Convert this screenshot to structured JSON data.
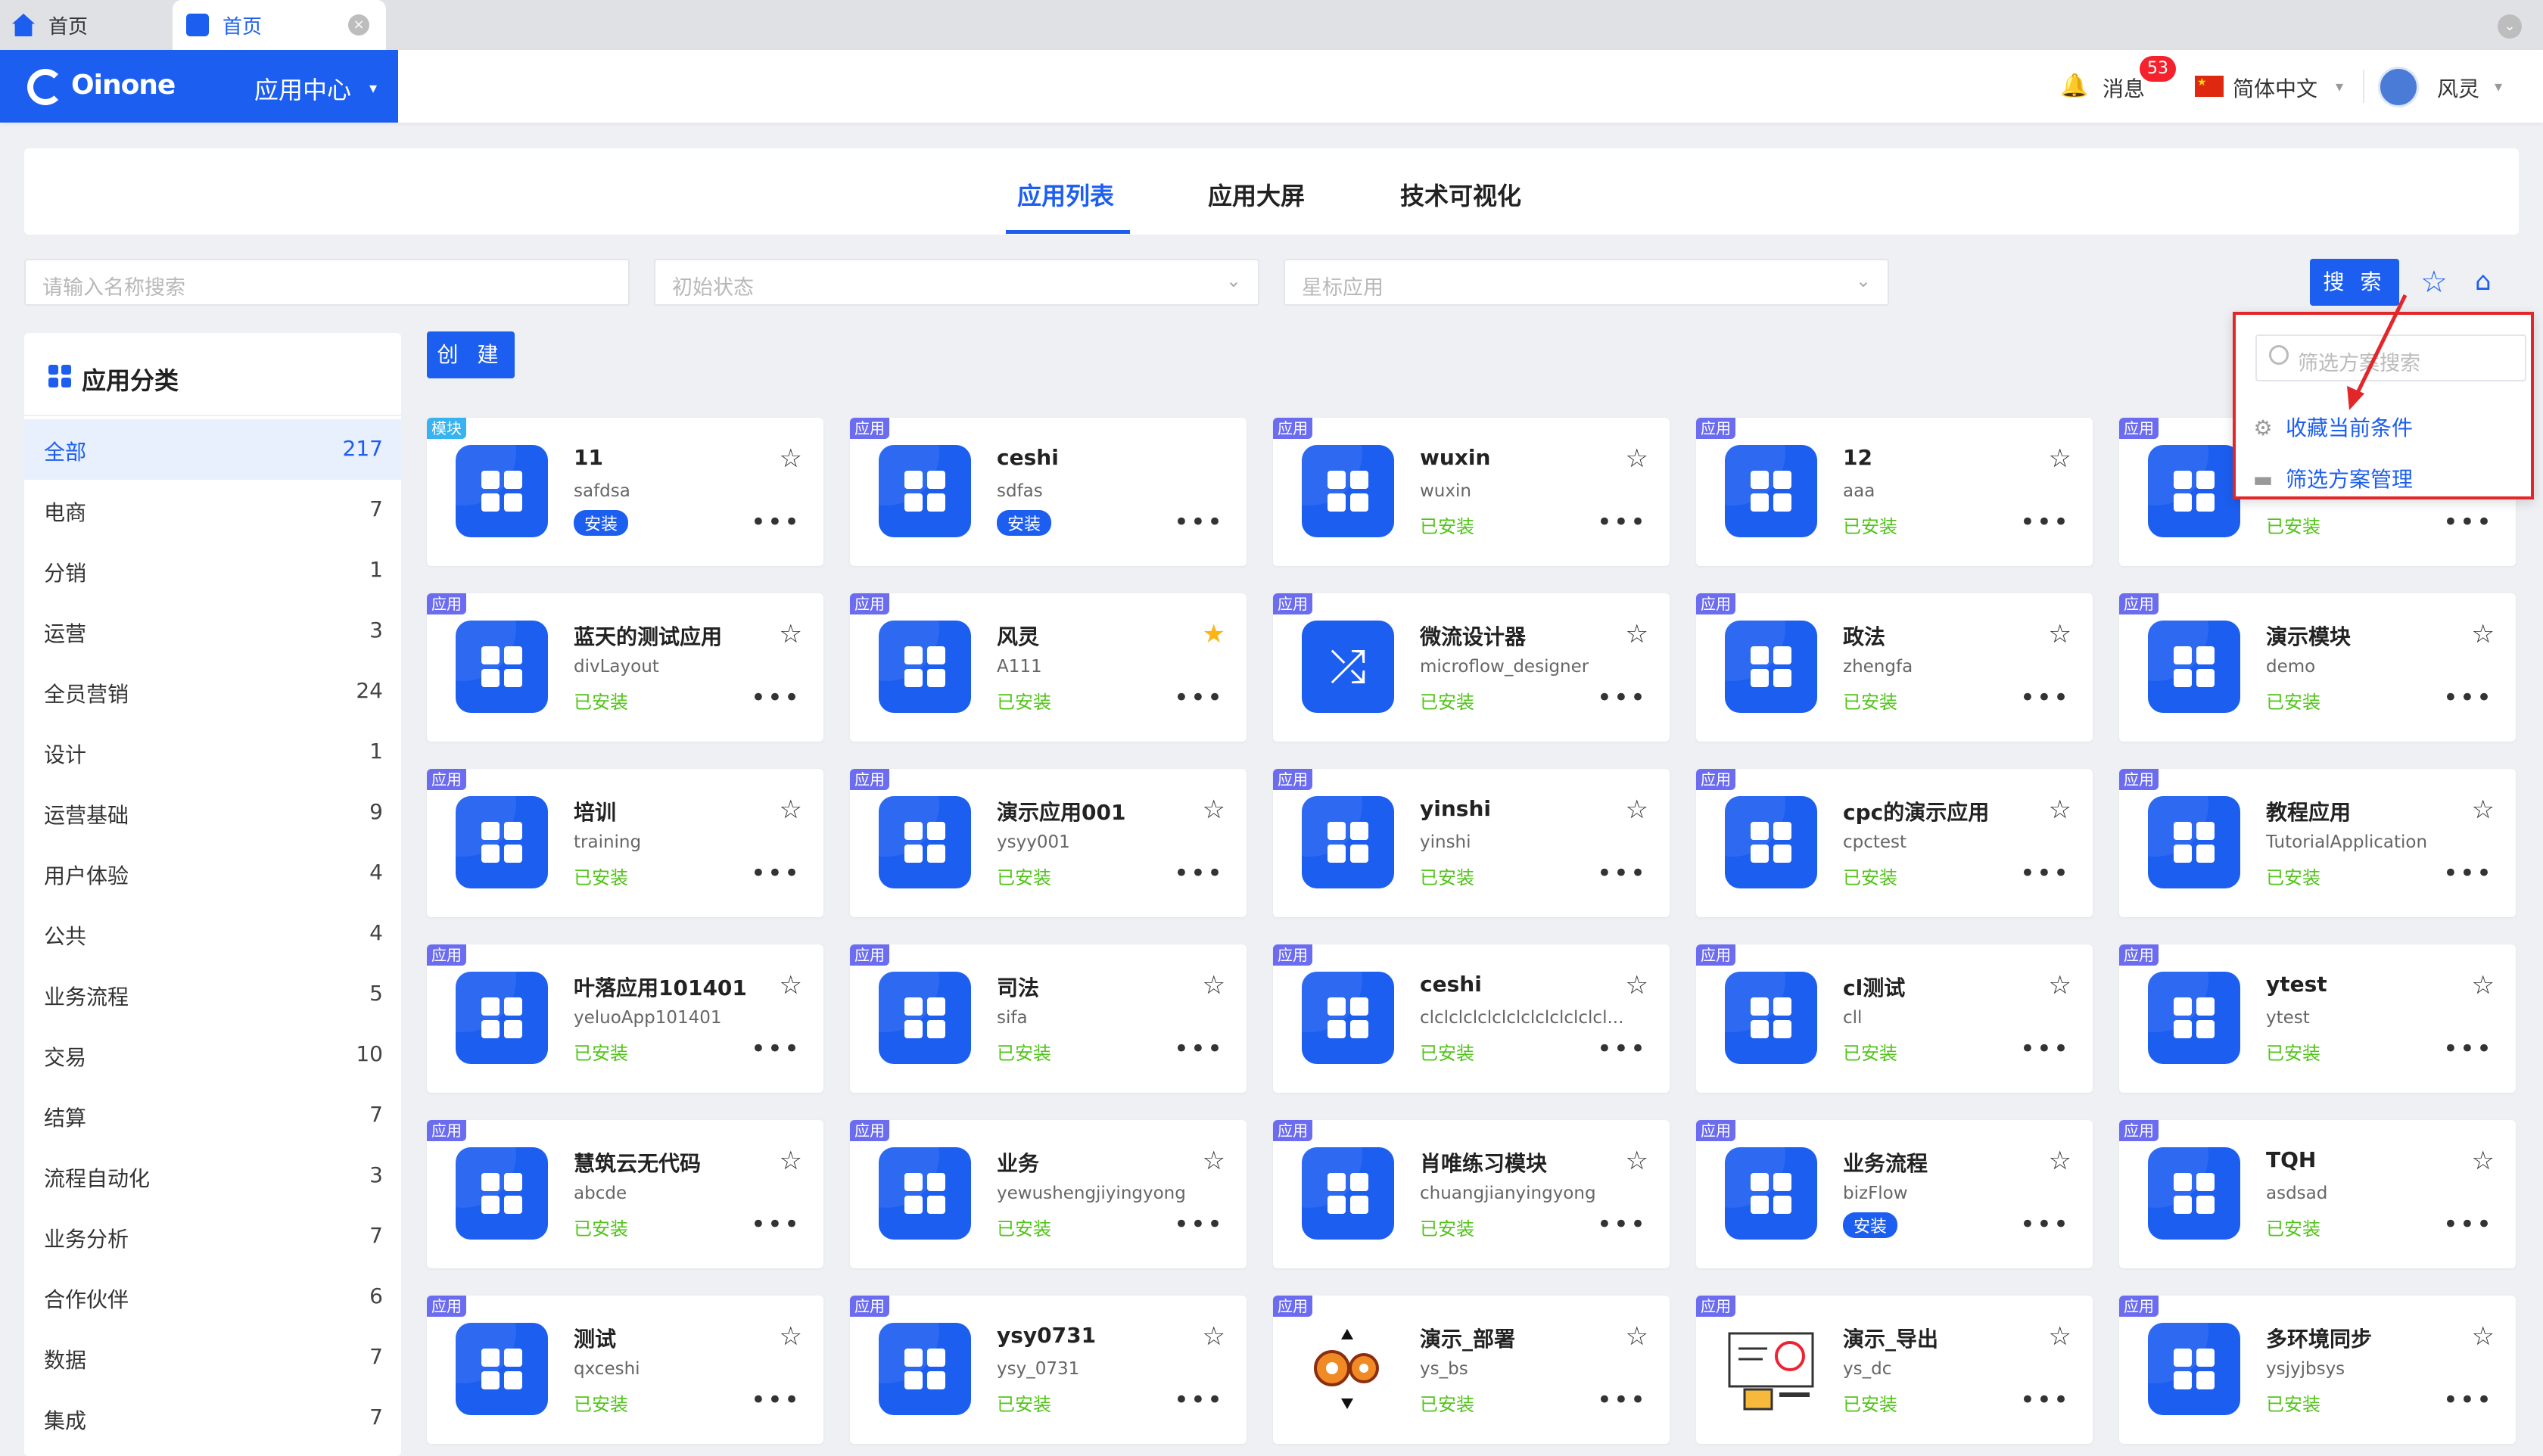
{
  "browser": {
    "tabs": [
      {
        "label": "首页"
      },
      {
        "label": "首页",
        "active": true,
        "close": "×"
      }
    ],
    "menu_chevron": "⌄"
  },
  "header": {
    "brand": "Oinone",
    "app_center": "应用中心",
    "caret": "▾",
    "messages_label": "消息",
    "messages_count": "53",
    "language": "简体中文",
    "user": "风灵",
    "brand_color": "#1c5ef0"
  },
  "nav": {
    "tabs": [
      "应用列表",
      "应用大屏",
      "技术可视化"
    ],
    "active_index": 0
  },
  "filters": {
    "name_placeholder": "请输入名称搜索",
    "status_placeholder": "初始状态",
    "star_placeholder": "星标应用",
    "search_label": "搜 索",
    "chevron": "⌄"
  },
  "sidebar": {
    "title": "应用分类",
    "categories": [
      {
        "name": "全部",
        "count": "217",
        "selected": true
      },
      {
        "name": "电商",
        "count": "7"
      },
      {
        "name": "分销",
        "count": "1"
      },
      {
        "name": "运营",
        "count": "3"
      },
      {
        "name": "全员营销",
        "count": "24"
      },
      {
        "name": "设计",
        "count": "1"
      },
      {
        "name": "运营基础",
        "count": "9"
      },
      {
        "name": "用户体验",
        "count": "4"
      },
      {
        "name": "公共",
        "count": "4"
      },
      {
        "name": "业务流程",
        "count": "5"
      },
      {
        "name": "交易",
        "count": "10"
      },
      {
        "name": "结算",
        "count": "7"
      },
      {
        "name": "流程自动化",
        "count": "3"
      },
      {
        "name": "业务分析",
        "count": "7"
      },
      {
        "name": "合作伙伴",
        "count": "6"
      },
      {
        "name": "数据",
        "count": "7"
      },
      {
        "name": "集成",
        "count": "7"
      }
    ]
  },
  "create_label": "创 建",
  "symbols": {
    "star_empty": "☆",
    "star_full": "★",
    "more": "•••"
  },
  "apps": [
    {
      "tag": "模块",
      "title": "11",
      "code": "safdsa",
      "status": "安装",
      "status_kind": "button",
      "starred": false,
      "icon": "grid"
    },
    {
      "tag": "应用",
      "title": "ceshi",
      "code": "sdfas",
      "status": "安装",
      "status_kind": "button",
      "starred": false,
      "icon": "grid",
      "no_star": true
    },
    {
      "tag": "应用",
      "title": "wuxin",
      "code": "wuxin",
      "status": "已安装",
      "status_kind": "text",
      "starred": false,
      "icon": "grid"
    },
    {
      "tag": "应用",
      "title": "12",
      "code": "aaa",
      "status": "已安装",
      "status_kind": "text",
      "starred": false,
      "icon": "grid"
    },
    {
      "tag": "应用",
      "title": "",
      "code": "",
      "status": "已安装",
      "status_kind": "text",
      "starred": false,
      "icon": "grid",
      "no_star": true
    },
    {
      "tag": "应用",
      "title": "蓝天的测试应用",
      "code": "divLayout",
      "status": "已安装",
      "status_kind": "text",
      "starred": false,
      "icon": "grid"
    },
    {
      "tag": "应用",
      "title": "风灵",
      "code": "A111",
      "status": "已安装",
      "status_kind": "text",
      "starred": true,
      "icon": "grid"
    },
    {
      "tag": "应用",
      "title": "微流设计器",
      "code": "microflow_designer",
      "status": "已安装",
      "status_kind": "text",
      "starred": false,
      "icon": "shuffle"
    },
    {
      "tag": "应用",
      "title": "政法",
      "code": "zhengfa",
      "status": "已安装",
      "status_kind": "text",
      "starred": false,
      "icon": "grid"
    },
    {
      "tag": "应用",
      "title": "演示模块",
      "code": "demo",
      "status": "已安装",
      "status_kind": "text",
      "starred": false,
      "icon": "grid"
    },
    {
      "tag": "应用",
      "title": "培训",
      "code": "training",
      "status": "已安装",
      "status_kind": "text",
      "starred": false,
      "icon": "grid"
    },
    {
      "tag": "应用",
      "title": "演示应用001",
      "code": "ysyy001",
      "status": "已安装",
      "status_kind": "text",
      "starred": false,
      "icon": "grid"
    },
    {
      "tag": "应用",
      "title": "yinshi",
      "code": "yinshi",
      "status": "已安装",
      "status_kind": "text",
      "starred": false,
      "icon": "grid"
    },
    {
      "tag": "应用",
      "title": "cpc的演示应用",
      "code": "cpctest",
      "status": "已安装",
      "status_kind": "text",
      "starred": false,
      "icon": "grid"
    },
    {
      "tag": "应用",
      "title": "教程应用",
      "code": "TutorialApplication",
      "status": "已安装",
      "status_kind": "text",
      "starred": false,
      "icon": "grid"
    },
    {
      "tag": "应用",
      "title": "叶落应用101401",
      "code": "yeluoApp101401",
      "status": "已安装",
      "status_kind": "text",
      "starred": false,
      "icon": "grid"
    },
    {
      "tag": "应用",
      "title": "司法",
      "code": "sifa",
      "status": "已安装",
      "status_kind": "text",
      "starred": false,
      "icon": "grid"
    },
    {
      "tag": "应用",
      "title": "ceshi",
      "code": "clclclclclclclclclclclclcl...",
      "status": "已安装",
      "status_kind": "text",
      "starred": false,
      "icon": "grid"
    },
    {
      "tag": "应用",
      "title": "cl测试",
      "code": "cll",
      "status": "已安装",
      "status_kind": "text",
      "starred": false,
      "icon": "grid"
    },
    {
      "tag": "应用",
      "title": "ytest",
      "code": "ytest",
      "status": "已安装",
      "status_kind": "text",
      "starred": false,
      "icon": "grid"
    },
    {
      "tag": "应用",
      "title": "慧筑云无代码",
      "code": "abcde",
      "status": "已安装",
      "status_kind": "text",
      "starred": false,
      "icon": "grid"
    },
    {
      "tag": "应用",
      "title": "业务",
      "code": "yewushengjiyingyong",
      "status": "已安装",
      "status_kind": "text",
      "starred": false,
      "icon": "grid"
    },
    {
      "tag": "应用",
      "title": "肖唯练习模块",
      "code": "chuangjianyingyong",
      "status": "已安装",
      "status_kind": "text",
      "starred": false,
      "icon": "grid"
    },
    {
      "tag": "应用",
      "title": "业务流程",
      "code": "bizFlow",
      "status": "安装",
      "status_kind": "button",
      "starred": false,
      "icon": "grid"
    },
    {
      "tag": "应用",
      "title": "TQH",
      "code": "asdsad",
      "status": "已安装",
      "status_kind": "text",
      "starred": false,
      "icon": "grid"
    },
    {
      "tag": "应用",
      "title": "测试",
      "code": "qxceshi",
      "status": "已安装",
      "status_kind": "text",
      "starred": false,
      "icon": "grid"
    },
    {
      "tag": "应用",
      "title": "ysy0731",
      "code": "ysy_0731",
      "status": "已安装",
      "status_kind": "text",
      "starred": false,
      "icon": "grid"
    },
    {
      "tag": "应用",
      "title": "演示_部署",
      "code": "ys_bs",
      "status": "已安装",
      "status_kind": "text",
      "starred": false,
      "icon": "gears"
    },
    {
      "tag": "应用",
      "title": "演示_导出",
      "code": "ys_dc",
      "status": "已安装",
      "status_kind": "text",
      "starred": false,
      "icon": "presenter"
    },
    {
      "tag": "应用",
      "title": "多环境同步",
      "code": "ysjyjbsys",
      "status": "已安装",
      "status_kind": "text",
      "starred": false,
      "icon": "grid"
    }
  ],
  "popover": {
    "search_placeholder": "筛选方案搜索",
    "items": [
      {
        "label": "收藏当前条件",
        "icon": "⚙"
      },
      {
        "label": "筛选方案管理",
        "icon": "▬"
      }
    ],
    "highlight_color": "#e2262a"
  }
}
